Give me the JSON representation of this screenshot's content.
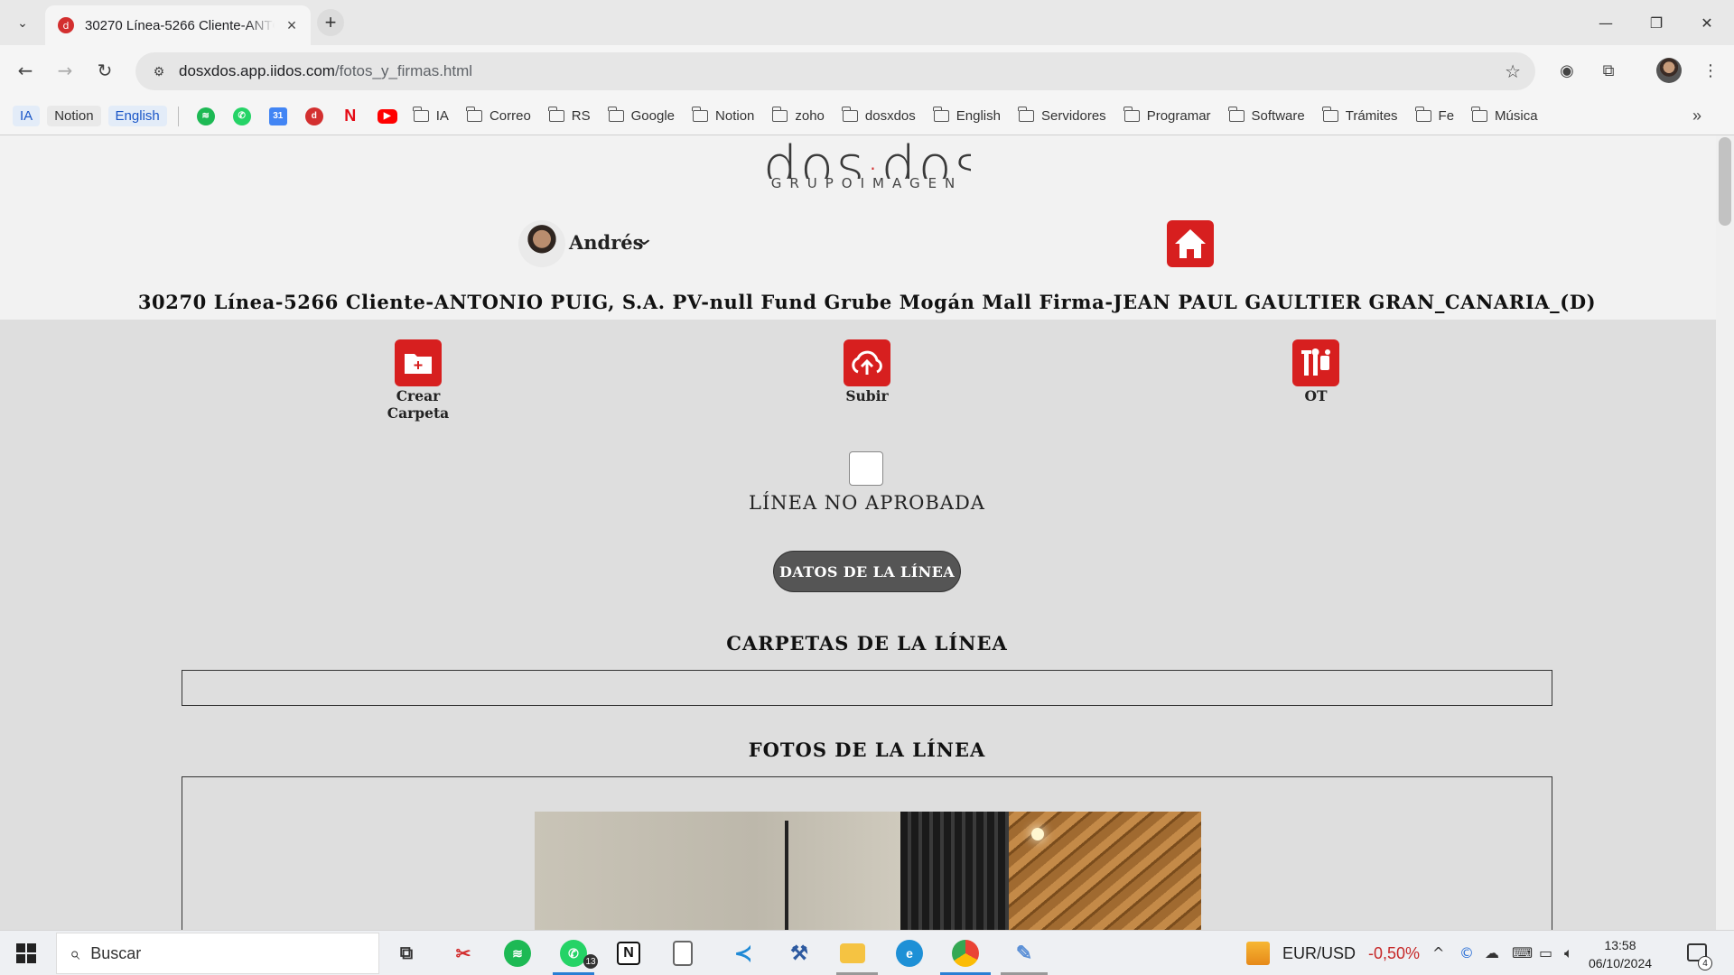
{
  "browser": {
    "tab_title": "30270 Línea-5266 Cliente-ANTONIO PUIG",
    "url_host": "dosxdos.app.iidos.com",
    "url_path": "/fotos_y_firmas.html",
    "bookmarks_pills": [
      "IA",
      "Notion",
      "English"
    ],
    "bookmark_folders": [
      "IA",
      "Correo",
      "RS",
      "Google",
      "Notion",
      "zoho",
      "dosxdos",
      "English",
      "Servidores",
      "Programar",
      "Software",
      "Trámites",
      "Fe",
      "Música"
    ],
    "calendar_day": "31"
  },
  "header": {
    "logo_main": "dos dos",
    "logo_sub": "GRUPOIMAGEN",
    "user_name": "Andrés",
    "line_title": "30270 Línea-5266 Cliente-ANTONIO PUIG, S.A. PV-null Fund Grube Mogán Mall Firma-JEAN PAUL GAULTIER GRAN_CANARIA_(D)"
  },
  "actions": [
    {
      "label_1": "Crear",
      "label_2": "Carpeta",
      "icon": "folder-plus-icon"
    },
    {
      "label_1": "Subir",
      "icon": "cloud-upload-icon"
    },
    {
      "label_1": "OT",
      "icon": "tools-icon"
    }
  ],
  "approval": {
    "checked": false,
    "label": "LÍNEA NO APROBADA"
  },
  "data_button_label": "DATOS DE LA LÍNEA",
  "sections": {
    "folders_title": "CARPETAS DE LA LÍNEA",
    "photos_title": "FOTOS DE LA LÍNEA"
  },
  "taskbar": {
    "search_placeholder": "Buscar",
    "whatsapp_badge": "13",
    "ticker_name": "EUR/USD",
    "ticker_value": "-0,50%",
    "time": "13:58",
    "date": "06/10/2024",
    "notifications": "4"
  },
  "colors": {
    "brand_red": "#d71f1f",
    "page_bg": "#dedede",
    "header_bg": "#f2f2f2"
  }
}
